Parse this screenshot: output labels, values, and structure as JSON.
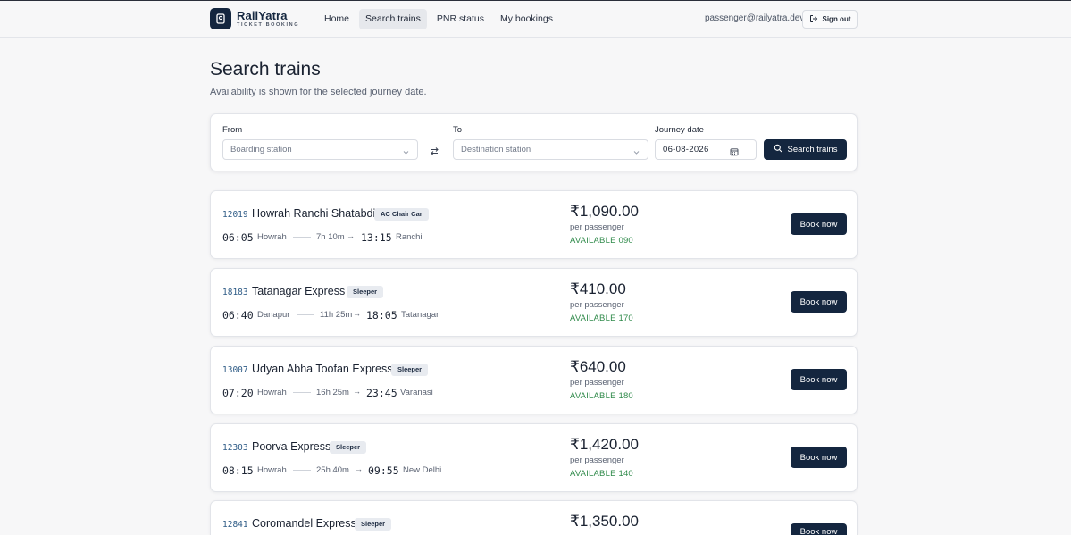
{
  "brand": {
    "name": "RailYatra",
    "tagline": "TICKET BOOKING",
    "logo_icon": "ticket-icon"
  },
  "nav": {
    "items": [
      {
        "label": "Home",
        "active": false
      },
      {
        "label": "Search trains",
        "active": true
      },
      {
        "label": "PNR status",
        "active": false
      },
      {
        "label": "My bookings",
        "active": false
      }
    ]
  },
  "user": {
    "email": "passenger@railyatra.dev",
    "signout_label": "Sign out"
  },
  "page": {
    "title": "Search trains",
    "subtitle": "Availability is shown for the selected journey date."
  },
  "search": {
    "from_label": "From",
    "from_placeholder": "Boarding station",
    "to_label": "To",
    "to_placeholder": "Destination station",
    "date_label": "Journey date",
    "date_value": "06-08-2026",
    "button_label": "Search trains"
  },
  "trains": [
    {
      "number": "12019",
      "name": "Howrah Ranchi Shatabdi",
      "class": "AC Chair Car",
      "dep_time": "06:05",
      "from": "Howrah",
      "duration": "7h 10m",
      "arr_time": "13:15",
      "to": "Ranchi",
      "price": "₹1,090.00",
      "per": "per passenger",
      "availability": "AVAILABLE 090",
      "book_label": "Book now"
    },
    {
      "number": "18183",
      "name": "Tatanagar Express",
      "class": "Sleeper",
      "dep_time": "06:40",
      "from": "Danapur",
      "duration": "11h 25m",
      "arr_time": "18:05",
      "to": "Tatanagar",
      "price": "₹410.00",
      "per": "per passenger",
      "availability": "AVAILABLE 170",
      "book_label": "Book now"
    },
    {
      "number": "13007",
      "name": "Udyan Abha Toofan Express",
      "class": "Sleeper",
      "dep_time": "07:20",
      "from": "Howrah",
      "duration": "16h 25m",
      "arr_time": "23:45",
      "to": "Varanasi",
      "price": "₹640.00",
      "per": "per passenger",
      "availability": "AVAILABLE 180",
      "book_label": "Book now"
    },
    {
      "number": "12303",
      "name": "Poorva Express",
      "class": "Sleeper",
      "dep_time": "08:15",
      "from": "Howrah",
      "duration": "25h 40m",
      "arr_time": "09:55",
      "to": "New Delhi",
      "price": "₹1,420.00",
      "per": "per passenger",
      "availability": "AVAILABLE 140",
      "book_label": "Book now"
    },
    {
      "number": "12841",
      "name": "Coromandel Express",
      "class": "Sleeper",
      "price": "₹1,350.00",
      "book_label": "Book now"
    }
  ],
  "colors": {
    "primary": "#14263f",
    "available": "#2f8a4a",
    "train_number": "#2e5b86"
  }
}
